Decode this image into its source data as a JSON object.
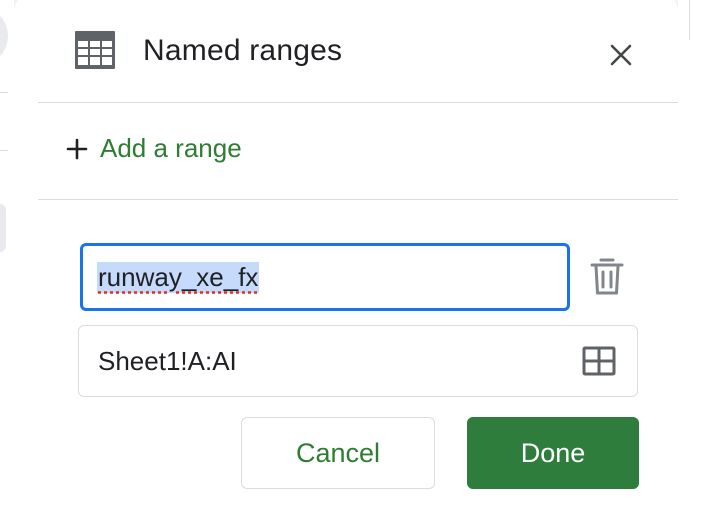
{
  "panel": {
    "title": "Named ranges",
    "icons": {
      "header": "table-icon",
      "close": "close-icon",
      "add": "plus-icon",
      "delete": "trash-icon",
      "select_range": "grid-icon"
    },
    "colors": {
      "accent_green": "#2e7d3c",
      "focus_blue": "#1a73e8",
      "selection_blue": "#c6dafc"
    }
  },
  "add_range": {
    "label": "Add a range"
  },
  "editor": {
    "name_value": "runway_xe_fx",
    "range_value": "Sheet1!A:AI"
  },
  "buttons": {
    "cancel": "Cancel",
    "done": "Done"
  }
}
